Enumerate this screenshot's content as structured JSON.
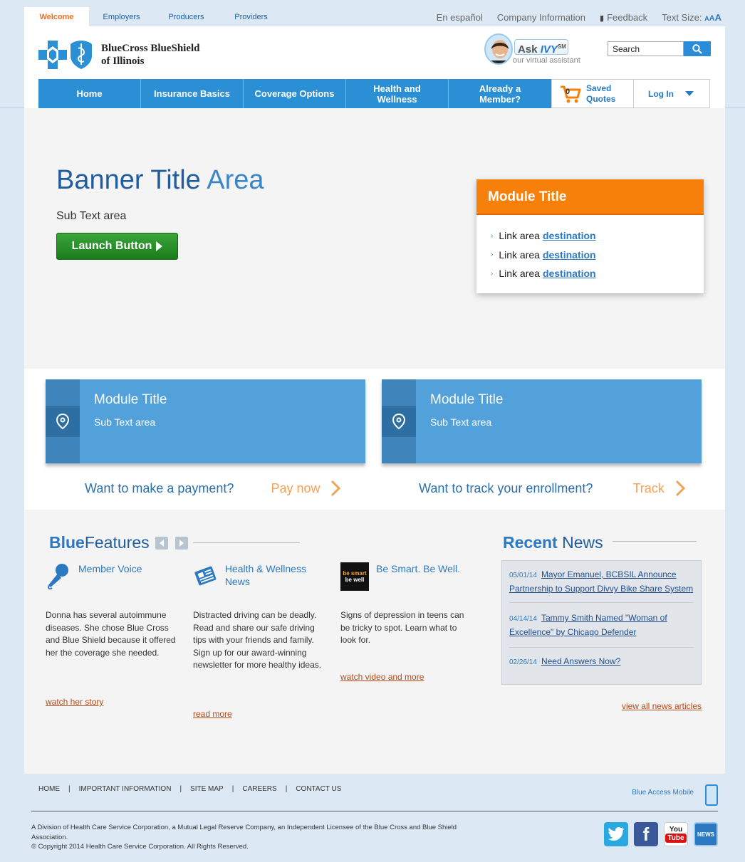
{
  "top_tabs": [
    "Welcome",
    "Employers",
    "Producers",
    "Providers"
  ],
  "utility_links": {
    "espanol": "En español",
    "company_info": "Company Information",
    "feedback": "Feedback",
    "text_size_label": "Text Size:",
    "text_size_glyphs": "AAA"
  },
  "logo": {
    "line1": "BlueCross BlueShield",
    "line2": "of Illinois"
  },
  "ivy": {
    "ask": "Ask",
    "name": "IVY",
    "sm": "SM",
    "sub": "our virtual assistant"
  },
  "search": {
    "placeholder": "Search"
  },
  "nav": {
    "items": [
      "Home",
      "Insurance Basics",
      "Coverage Options",
      "Health and Wellness",
      "Already a Member?"
    ],
    "cart_count": "0",
    "saved_quotes": "Saved Quotes",
    "login": "Log In"
  },
  "banner": {
    "title_main": "Banner Title",
    "title_accent": "Area",
    "sub": "Sub Text area",
    "button": "Launch Button"
  },
  "module_card": {
    "title": "Module Title",
    "links": [
      {
        "text": "Link area",
        "dest": "destination"
      },
      {
        "text": "Link area",
        "dest": "destination"
      },
      {
        "text": "Link area",
        "dest": "destination"
      }
    ]
  },
  "blue_modules": [
    {
      "title": "Module Title",
      "sub": "Sub Text area",
      "question": "Want to make a payment?",
      "action": "Pay now"
    },
    {
      "title": "Module Title",
      "sub": "Sub Text area",
      "question": "Want to track your enrollment?",
      "action": "Track"
    }
  ],
  "features": {
    "heading_bold": "Blue",
    "heading_rest": "Features",
    "items": [
      {
        "title": "Member Voice",
        "body": "Donna has several autoimmune diseases. She chose Blue Cross and Blue Shield because it offered her the coverage she needed.",
        "link": "watch her story",
        "icon": "microphone-icon"
      },
      {
        "title": "Health & Wellness News",
        "body": "Distracted driving can be deadly. Read and share our safe driving tips with your friends and family. Sign up for our award-winning newsletter for more healthy ideas.",
        "link": "read more",
        "icon": "newspaper-icon"
      },
      {
        "title": "Be Smart. Be Well.",
        "body": "Signs of depression in teens can be tricky to spot. Learn what to look for.",
        "link": "watch video and more",
        "icon": "be-smart-be-well-logo",
        "logo_line1": "be smart",
        "logo_line2": "be well"
      }
    ]
  },
  "news": {
    "heading_bold": "Recent",
    "heading_rest": "News",
    "items": [
      {
        "date": "05/01/14",
        "title": "Mayor Emanuel, BCBSIL Announce Partnership to Support Divvy Bike Share System"
      },
      {
        "date": "04/14/14",
        "title": "Tammy Smith Named \"Woman of Excellence\" by Chicago Defender"
      },
      {
        "date": "02/26/14",
        "title": "Need Answers Now?"
      }
    ],
    "view_all": "view all news articles"
  },
  "footer": {
    "links": [
      "HOME",
      "IMPORTANT INFORMATION",
      "SITE MAP",
      "CAREERS",
      "CONTACT US"
    ],
    "blue_access_mobile": "Blue Access Mobile",
    "legal_line1": "A Division of Health Care Service Corporation, a Mutual Legal Reserve Company, an Independent Licensee of the Blue Cross and Blue Shield Association.",
    "legal_line2": "© Copyright 2014 Health Care Service Corporation. All Rights Reserved.",
    "social": [
      {
        "name": "twitter-icon",
        "glyph": "t",
        "color": "#29a9e1"
      },
      {
        "name": "facebook-icon",
        "glyph": "f",
        "color": "#3b5998"
      },
      {
        "name": "youtube-icon",
        "glyph": "You Tube",
        "color": "#ffffff"
      },
      {
        "name": "news-icon",
        "glyph": "NEWS",
        "color": "#2b79c2"
      }
    ]
  },
  "colors": {
    "brand_blue": "#2b8fd6",
    "accent_orange": "#f7800a",
    "launch_green": "#2a932a",
    "link_orange": "#b54b1a"
  }
}
